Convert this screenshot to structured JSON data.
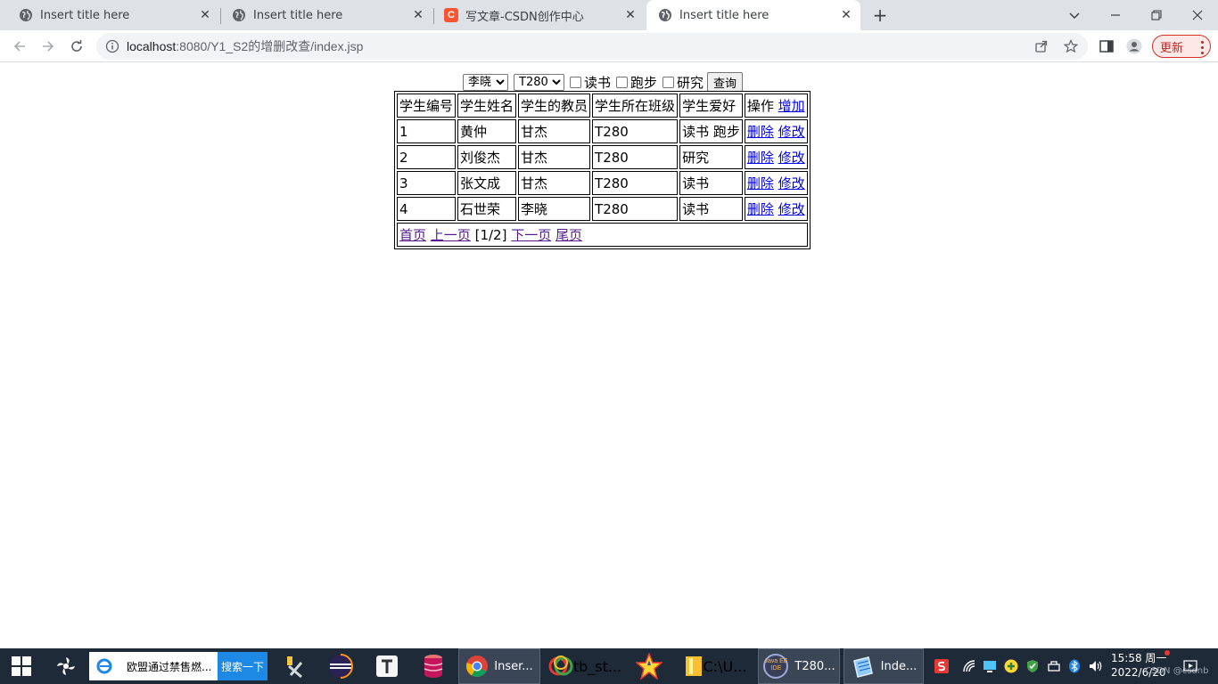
{
  "browser": {
    "tabs": [
      {
        "title": "Insert title here",
        "icon": "globe-icon",
        "active": false
      },
      {
        "title": "Insert title here",
        "icon": "globe-icon",
        "active": false
      },
      {
        "title": "写文章-CSDN创作中心",
        "icon": "csdn-icon",
        "active": false
      },
      {
        "title": "Insert title here",
        "icon": "globe-icon",
        "active": true
      }
    ],
    "url_host": "localhost",
    "url_path": ":8080/Y1_S2的增删改查/index.jsp",
    "update_label": "更新",
    "csdn_letter": "C"
  },
  "query": {
    "teacher_selected": "李晓",
    "class_selected": "T280",
    "hobbies": [
      "读书",
      "跑步",
      "研究"
    ],
    "submit_label": "查询"
  },
  "table": {
    "headers": [
      "学生编号",
      "学生姓名",
      "学生的教员",
      "学生所在班级",
      "学生爱好",
      "操作"
    ],
    "add_label": "增加",
    "delete_label": "删除",
    "edit_label": "修改",
    "rows": [
      {
        "id": "1",
        "name": "黄仲",
        "teacher": "甘杰",
        "class": "T280",
        "hobby": "读书 跑步"
      },
      {
        "id": "2",
        "name": "刘俊杰",
        "teacher": "甘杰",
        "class": "T280",
        "hobby": "研究"
      },
      {
        "id": "3",
        "name": "张文成",
        "teacher": "甘杰",
        "class": "T280",
        "hobby": "读书"
      },
      {
        "id": "4",
        "name": "石世荣",
        "teacher": "李晓",
        "class": "T280",
        "hobby": "读书"
      }
    ],
    "pager": {
      "first": "首页",
      "prev": "上一页",
      "status": "[1/2]",
      "next": "下一页",
      "last": "尾页"
    }
  },
  "taskbar": {
    "search_text": "欧盟通过禁售燃...",
    "search_button": "搜索一下",
    "windows": [
      "Inser...",
      "tb_st...",
      "C:\\U...",
      "T280...",
      "Inde..."
    ],
    "javaee_badge": "Java EE IDE",
    "time": "15:58 周一",
    "date": "2022/6/20",
    "watermark": "CSDN @csdnb"
  },
  "colors": {
    "tabstrip": "#dee1e6",
    "link": "#0000ee",
    "visited_link": "#551a8b",
    "taskbar": "#1f2a38",
    "update_accent": "#d93025"
  }
}
